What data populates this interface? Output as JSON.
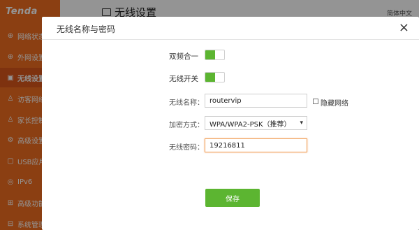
{
  "brand": "Tenda",
  "page_title": "无线设置",
  "language": "简体中文",
  "sidebar": {
    "items": [
      {
        "label": "网络状态",
        "icon": "globe-icon"
      },
      {
        "label": "外网设置",
        "icon": "globe-icon"
      },
      {
        "label": "无线设置",
        "icon": "wifi-icon",
        "active": true
      },
      {
        "label": "访客网络",
        "icon": "user-icon"
      },
      {
        "label": "家长控制",
        "icon": "user-icon"
      },
      {
        "label": "高级设置",
        "icon": "gear-icon"
      },
      {
        "label": "USB应用",
        "icon": "usb-icon"
      },
      {
        "label": "IPv6",
        "icon": "ipv6-icon"
      },
      {
        "label": "高级功能",
        "icon": "grid-icon"
      },
      {
        "label": "系统管理",
        "icon": "system-icon"
      }
    ]
  },
  "modal": {
    "title": "无线名称与密码",
    "close_glyph": "×",
    "dual_band": {
      "label": "双频合一",
      "on": true
    },
    "wifi_switch": {
      "label": "无线开关",
      "on": true
    },
    "ssid": {
      "label": "无线名称：",
      "value": "routervip"
    },
    "hide_network": {
      "label": "隐藏网络",
      "checked": false
    },
    "encryption": {
      "label": "加密方式：",
      "value": "WPA/WPA2-PSK（推荐）"
    },
    "password": {
      "label": "无线密码：",
      "value": "19216811"
    },
    "save_label": "保存"
  },
  "colors": {
    "accent": "#f06d1f",
    "toggle_on": "#5cb531",
    "save": "#5cb531"
  }
}
